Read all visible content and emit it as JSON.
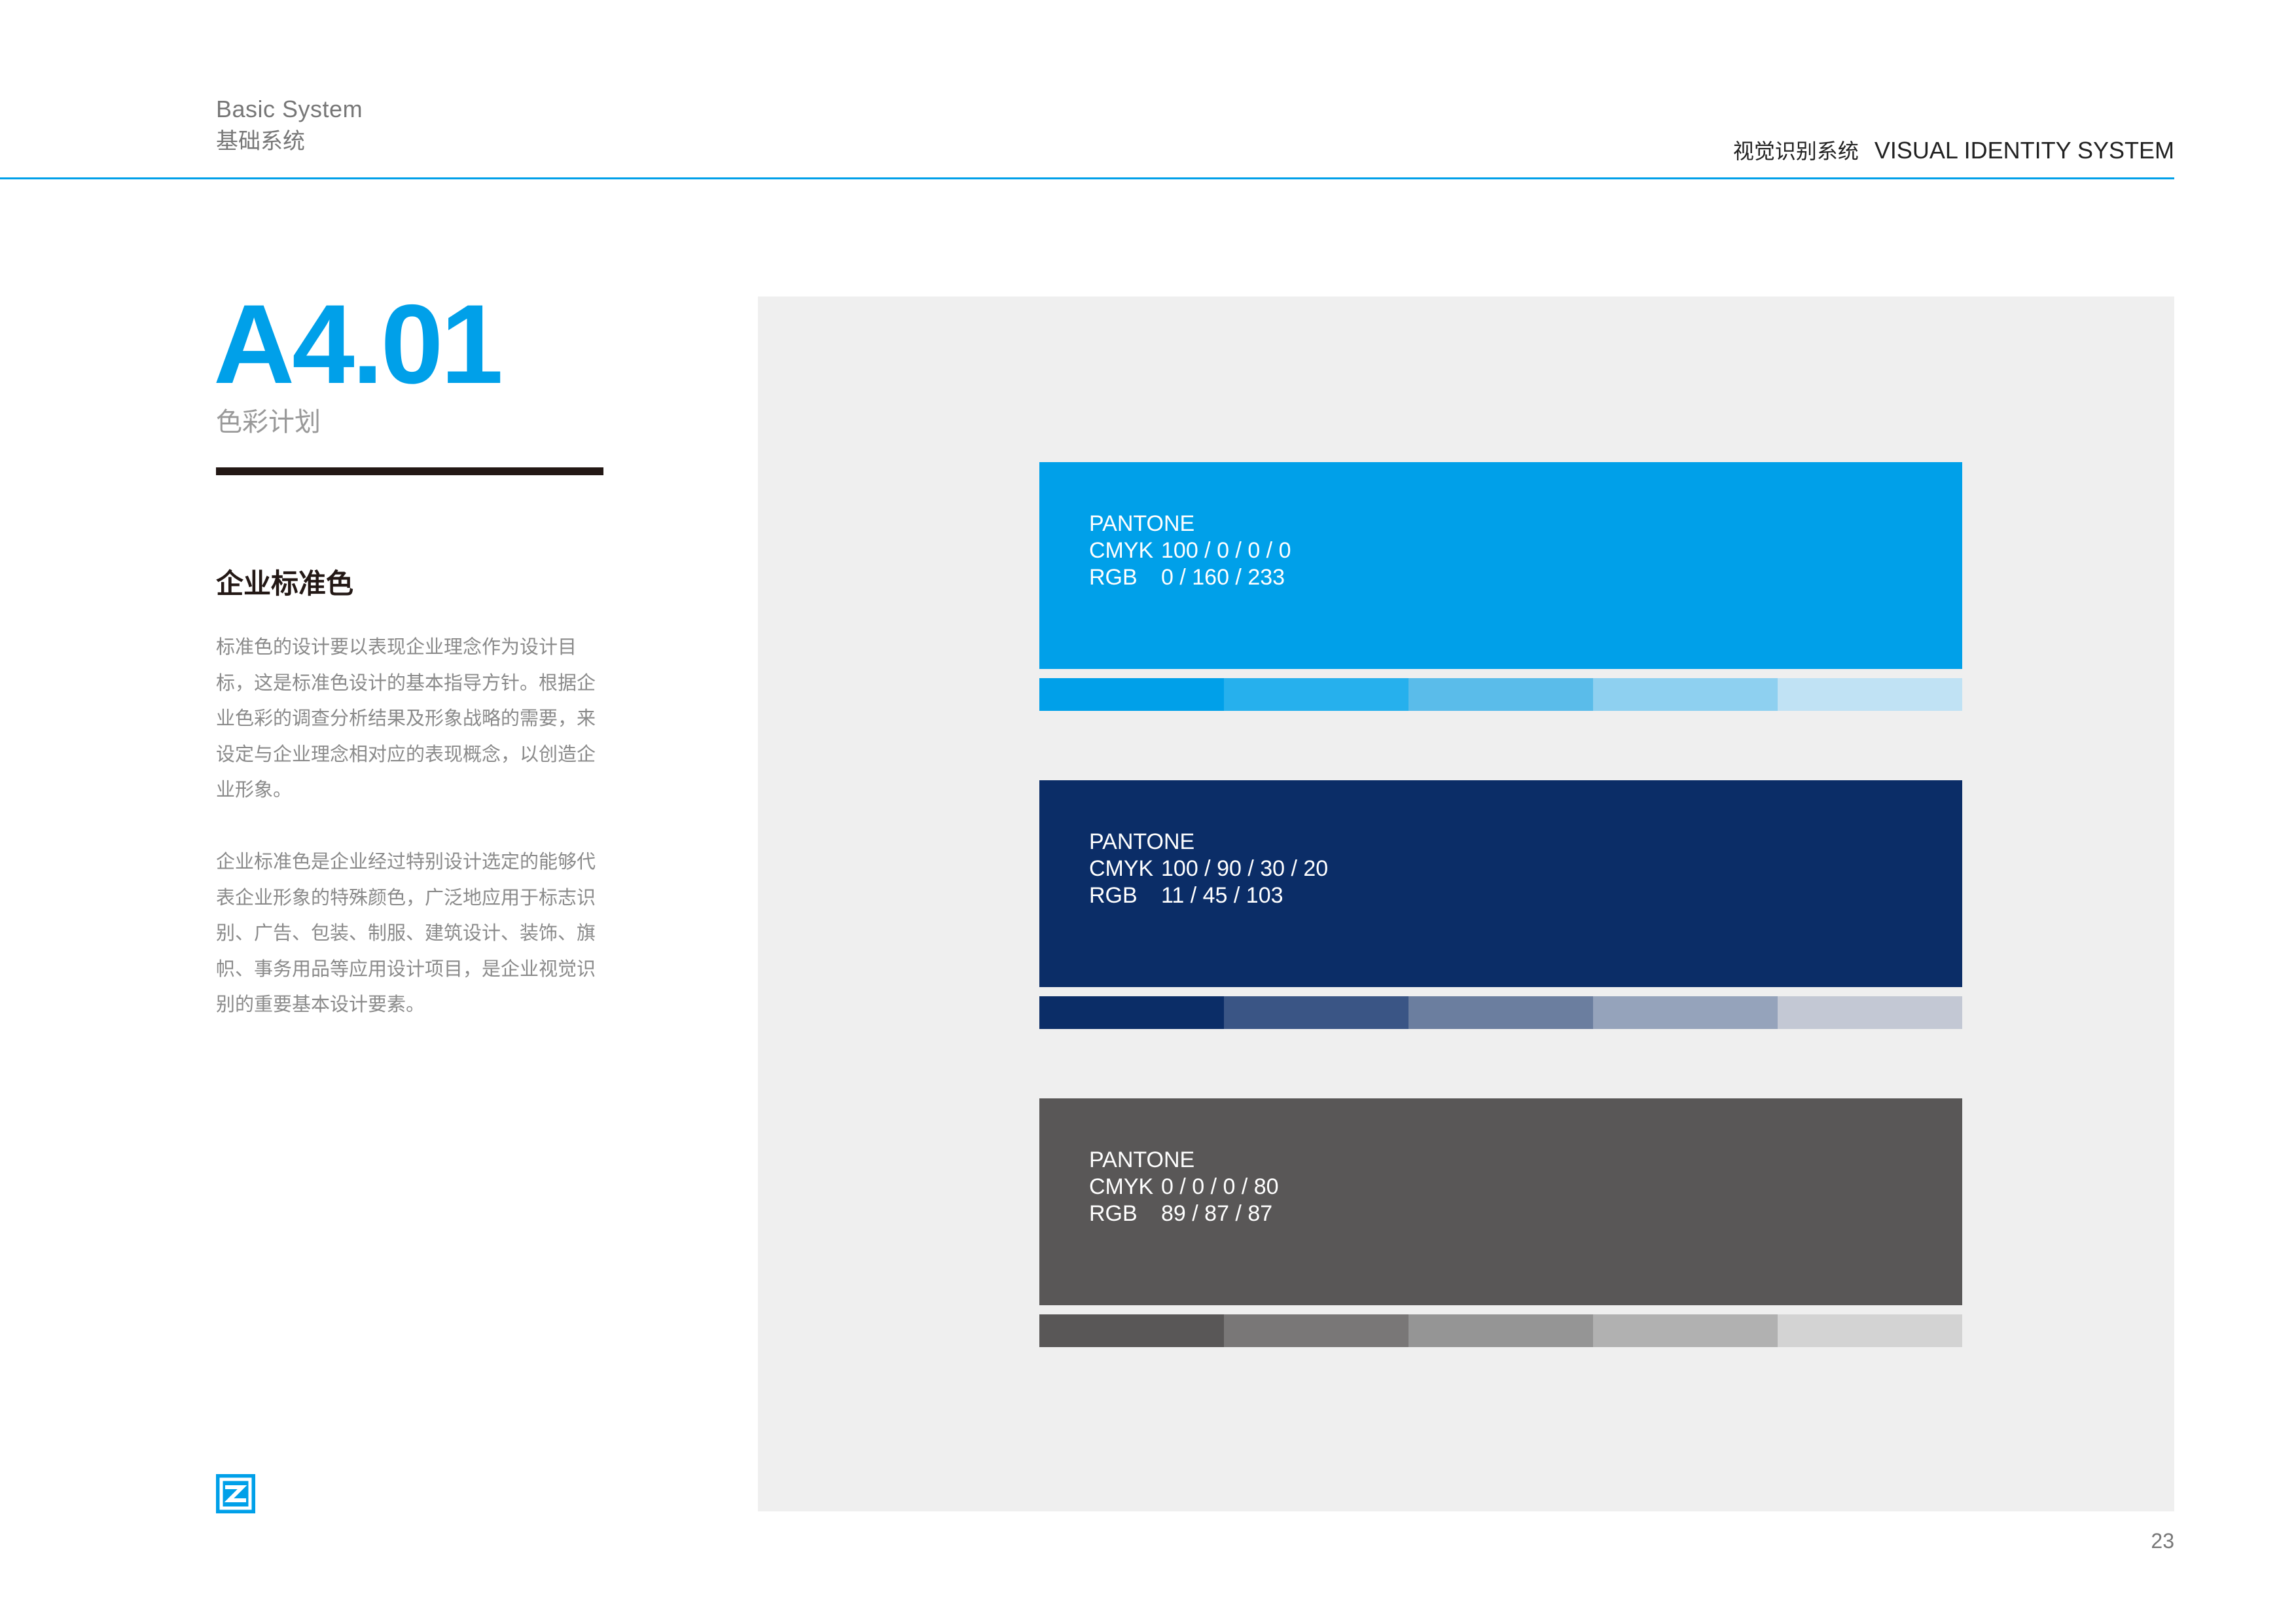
{
  "header": {
    "section_en": "Basic System",
    "section_cn": "基础系统",
    "system_cn": "视觉识别系统",
    "system_en": "VISUAL IDENTITY SYSTEM"
  },
  "heading": {
    "code": "A4.01",
    "subtitle": "色彩计划"
  },
  "content": {
    "title": "企业标准色",
    "paragraph_1": "标准色的设计要以表现企业理念作为设计目标，这是标准色设计的基本指导方针。根据企业色彩的调查分析结果及形象战略的需要，来设定与企业理念相对应的表现概念，以创造企业形象。",
    "paragraph_2": "企业标准色是企业经过特别设计选定的能够代表企业形象的特殊颜色，广泛地应用于标志识别、广告、包装、制服、建筑设计、装饰、旗帜、事务用品等应用设计项目，是企业视觉识别的重要基本设计要素。"
  },
  "colors": [
    {
      "hex": "#00a0e9",
      "pantone_label": "PANTONE",
      "cmyk_label": "CMYK",
      "cmyk": "100 / 0 / 0 / 0",
      "rgb_label": "RGB",
      "rgb": "0 / 160 / 233",
      "tints": [
        "#00a0e9",
        "#26b0ed",
        "#5abcea",
        "#8ed0f0",
        "#c0e2f4"
      ]
    },
    {
      "hex": "#0b2d67",
      "pantone_label": "PANTONE",
      "cmyk_label": "CMYK",
      "cmyk": "100 / 90 / 30 / 20",
      "rgb_label": "RGB",
      "rgb": "11 / 45 / 103",
      "tints": [
        "#0b2d67",
        "#3a5585",
        "#6b7e9f",
        "#95a3bb",
        "#c3c8d4"
      ]
    },
    {
      "hex": "#595757",
      "pantone_label": "PANTONE",
      "cmyk_label": "CMYK",
      "cmyk": "0 / 0 / 0 / 80",
      "rgb_label": "RGB",
      "rgb": "89 / 87 / 87",
      "tints": [
        "#595757",
        "#797777",
        "#959595",
        "#b1b1b1",
        "#d3d3d3"
      ]
    }
  ],
  "footer": {
    "page_number": "23",
    "logo_icon": "brand-logo-icon"
  }
}
